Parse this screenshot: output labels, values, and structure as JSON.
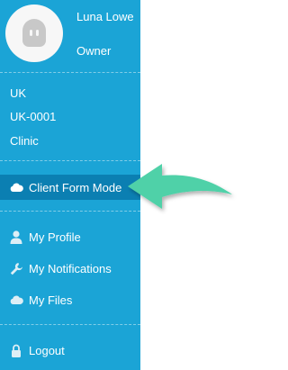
{
  "profile": {
    "name": "Luna Lowe",
    "role": "Owner"
  },
  "location": {
    "country": "UK",
    "code": "UK-0001",
    "type": "Clinic"
  },
  "menu": {
    "client_form_mode": "Client Form Mode",
    "my_profile": "My Profile",
    "my_notifications": "My Notifications",
    "my_files": "My Files",
    "logout": "Logout"
  },
  "colors": {
    "sidebar": "#1ba4d6",
    "active": "#0b7fb2",
    "arrow": "#4fd1a8"
  },
  "icons": [
    "user-avatar-icon",
    "cloud-icon",
    "person-icon",
    "wrench-icon",
    "cloud-icon",
    "lock-icon",
    "curved-arrow-icon"
  ]
}
